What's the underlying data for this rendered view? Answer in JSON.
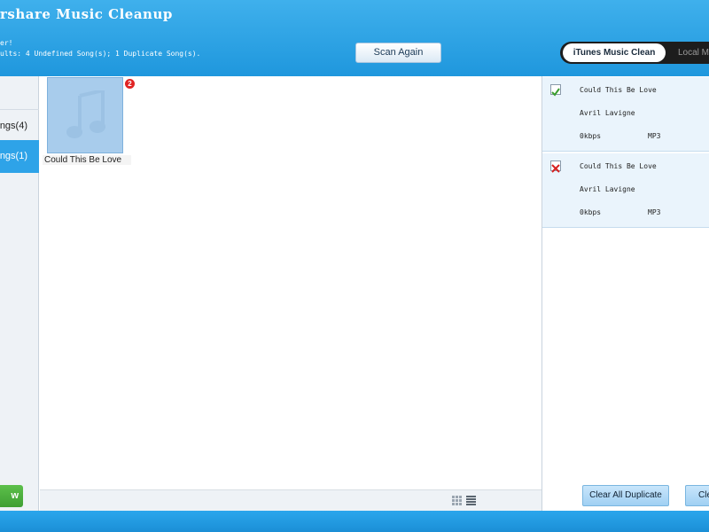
{
  "app": {
    "title": "rshare Music Cleanup",
    "status_line1": "er!",
    "status_line2": "ults: 4 Undefined Song(s); 1 Duplicate Song(s)."
  },
  "header": {
    "scan_again_label": "Scan Again",
    "mode_active_label": "iTunes Music Clean",
    "mode_inactive_label": "Local M"
  },
  "sidebar": {
    "items": [
      {
        "label": "ngs(4)"
      },
      {
        "label": "ngs(1)"
      }
    ],
    "fix_label": "w"
  },
  "grid": {
    "tiles": [
      {
        "title": "Could This Be Love",
        "badge": "2"
      }
    ]
  },
  "detail": {
    "cards": [
      {
        "checked": true,
        "title": "Could This Be Love",
        "artist": "Avril Lavigne",
        "bitrate": "0kbps",
        "format": "MP3"
      },
      {
        "checked": false,
        "title": "Could This Be Love",
        "artist": "Avril Lavigne",
        "bitrate": "0kbps",
        "format": "MP3"
      }
    ],
    "clear_all_duplicate_label": "Clear All Duplicate",
    "second_button_label": "Cle"
  },
  "colors": {
    "header_blue": "#1f97dd",
    "selected_blue": "#2ea3e8",
    "badge_red": "#e02424",
    "fix_green": "#4cae3c",
    "check_green": "#3a9d2f",
    "cross_red": "#d62020"
  }
}
